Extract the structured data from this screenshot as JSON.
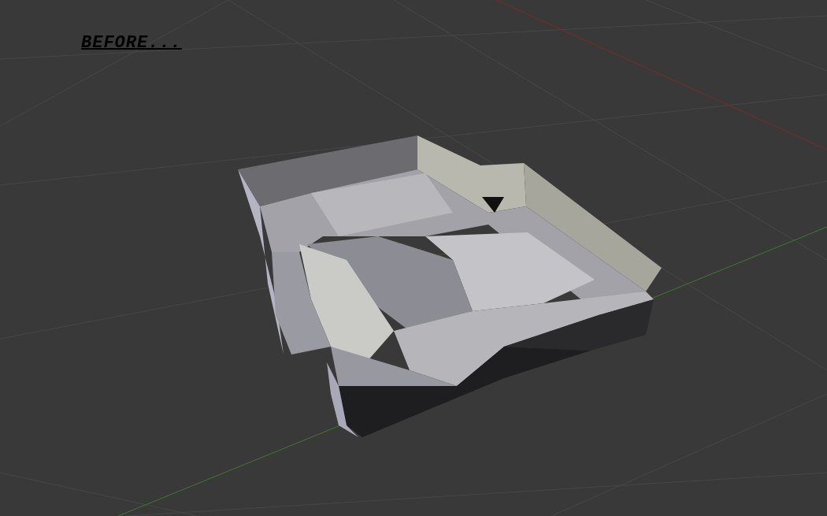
{
  "viewport": {
    "caption": "BEFORE..."
  }
}
